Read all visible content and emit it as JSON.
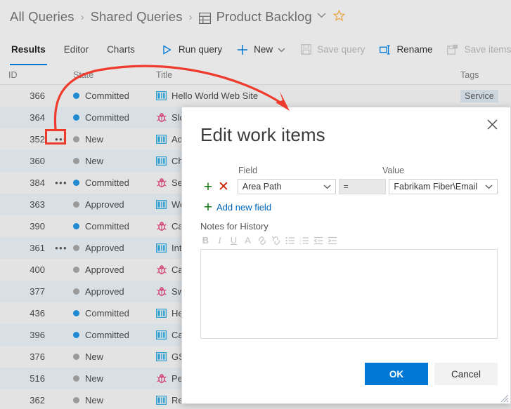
{
  "breadcrumb": {
    "items": [
      {
        "label": "All Queries",
        "icon": null
      },
      {
        "label": "Shared Queries",
        "icon": null
      },
      {
        "label": "Product Backlog",
        "icon": "query-grid-icon"
      }
    ],
    "separator": "›",
    "dropdown_icon": "chevron-down-icon",
    "favorite_icon": "star-outline-icon"
  },
  "commandbar": {
    "pivots": [
      {
        "label": "Results",
        "active": true
      },
      {
        "label": "Editor",
        "active": false
      },
      {
        "label": "Charts",
        "active": false
      }
    ],
    "commands": [
      {
        "label": "Run query",
        "icon": "play-icon",
        "disabled": false,
        "dropdown": false
      },
      {
        "label": "New",
        "icon": "plus-icon",
        "disabled": false,
        "dropdown": true
      },
      {
        "label": "Save query",
        "icon": "save-icon",
        "disabled": true,
        "dropdown": false
      },
      {
        "label": "Rename",
        "icon": "rename-icon",
        "disabled": false,
        "dropdown": false
      },
      {
        "label": "Save items",
        "icon": "save-items-icon",
        "disabled": true,
        "dropdown": false
      }
    ]
  },
  "grid": {
    "columns": [
      {
        "key": "id",
        "label": "ID"
      },
      {
        "key": "ellipsis",
        "label": ""
      },
      {
        "key": "state",
        "label": "State"
      },
      {
        "key": "title",
        "label": "Title"
      },
      {
        "key": "tags",
        "label": "Tags"
      }
    ],
    "rows": [
      {
        "id": "366",
        "ellipsis": "",
        "state": "Committed",
        "state_color": "blue",
        "type_icon": "backlog-item-icon",
        "title": "Hello World Web Site",
        "tags": "Service"
      },
      {
        "id": "364",
        "ellipsis": "",
        "state": "Committed",
        "state_color": "blue",
        "type_icon": "bug-icon",
        "title": "Slo",
        "tags": ""
      },
      {
        "id": "352",
        "ellipsis": "•••",
        "state": "New",
        "state_color": "gray",
        "type_icon": "backlog-item-icon",
        "title": "Ad",
        "tags": ""
      },
      {
        "id": "360",
        "ellipsis": "",
        "state": "New",
        "state_color": "gray",
        "type_icon": "backlog-item-icon",
        "title": "Ch",
        "tags": ""
      },
      {
        "id": "384",
        "ellipsis": "•••",
        "state": "Committed",
        "state_color": "blue",
        "type_icon": "bug-icon",
        "title": "Sec",
        "tags": ""
      },
      {
        "id": "363",
        "ellipsis": "",
        "state": "Approved",
        "state_color": "gray",
        "type_icon": "backlog-item-icon",
        "title": "We",
        "tags": ""
      },
      {
        "id": "390",
        "ellipsis": "",
        "state": "Committed",
        "state_color": "blue",
        "type_icon": "bug-icon",
        "title": "Ca",
        "tags": ""
      },
      {
        "id": "361",
        "ellipsis": "•••",
        "state": "Approved",
        "state_color": "gray",
        "type_icon": "backlog-item-icon",
        "title": "Int",
        "tags": ""
      },
      {
        "id": "400",
        "ellipsis": "",
        "state": "Approved",
        "state_color": "gray",
        "type_icon": "bug-icon",
        "title": "Ca",
        "tags": ""
      },
      {
        "id": "377",
        "ellipsis": "",
        "state": "Approved",
        "state_color": "gray",
        "type_icon": "bug-icon",
        "title": "Sw",
        "tags": ""
      },
      {
        "id": "436",
        "ellipsis": "",
        "state": "Committed",
        "state_color": "blue",
        "type_icon": "backlog-item-icon",
        "title": "He",
        "tags": ""
      },
      {
        "id": "396",
        "ellipsis": "",
        "state": "Committed",
        "state_color": "blue",
        "type_icon": "backlog-item-icon",
        "title": "Ca",
        "tags": ""
      },
      {
        "id": "376",
        "ellipsis": "",
        "state": "New",
        "state_color": "gray",
        "type_icon": "backlog-item-icon",
        "title": "GS",
        "tags": ""
      },
      {
        "id": "516",
        "ellipsis": "",
        "state": "New",
        "state_color": "gray",
        "type_icon": "bug-icon",
        "title": "Per",
        "tags": ""
      },
      {
        "id": "362",
        "ellipsis": "",
        "state": "New",
        "state_color": "gray",
        "type_icon": "backlog-item-icon",
        "title": "Res",
        "tags": ""
      }
    ]
  },
  "dialog": {
    "title": "Edit work items",
    "close_icon": "close-icon",
    "labels": {
      "field": "Field",
      "value": "Value",
      "notes": "Notes for History"
    },
    "clause": {
      "add_icon": "plus-icon",
      "remove_icon": "remove-x-icon",
      "field_value": "Area Path",
      "operator": "=",
      "value_value": "Fabrikam Fiber\\Email",
      "field_dropdown_icon": "chevron-down-icon",
      "value_dropdown_icon": "chevron-down-icon"
    },
    "add_new_field": {
      "icon": "plus-icon",
      "label": "Add new field"
    },
    "rte_toolbar": [
      {
        "name": "bold-icon",
        "glyph": "B"
      },
      {
        "name": "italic-icon",
        "glyph": "I"
      },
      {
        "name": "underline-icon",
        "glyph": "U"
      },
      {
        "name": "clear-format-icon",
        "glyph": "A"
      },
      {
        "name": "link-icon",
        "glyph": "🔗"
      },
      {
        "name": "unlink-icon",
        "glyph": "🔗"
      },
      {
        "name": "bullet-list-icon",
        "glyph": "☰"
      },
      {
        "name": "numbered-list-icon",
        "glyph": "☰"
      },
      {
        "name": "outdent-icon",
        "glyph": "⬅"
      },
      {
        "name": "indent-icon",
        "glyph": "➡"
      }
    ],
    "notes_value": "",
    "buttons": {
      "ok": "OK",
      "cancel": "Cancel"
    },
    "resize_grip_icon": "resize-grip-icon"
  },
  "annotation": {
    "color": "#ef3b2d",
    "highlight_target": "row-352-ellipsis-button",
    "arrow_points_to": "edit-work-items-dialog"
  }
}
